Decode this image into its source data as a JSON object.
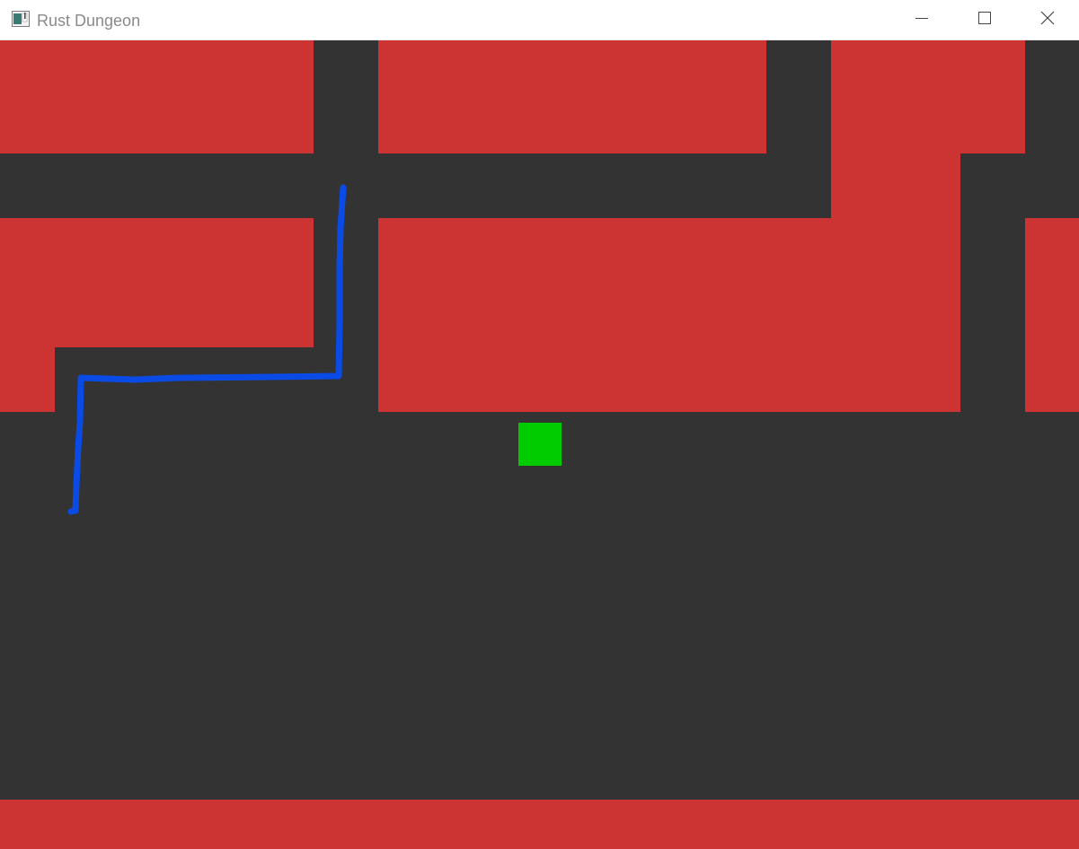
{
  "window": {
    "title": "Rust Dungeon",
    "icon": "app-window-icon",
    "controls": {
      "minimize_icon": "minimize-icon",
      "maximize_icon": "maximize-icon",
      "close_icon": "close-icon"
    }
  },
  "game": {
    "colors": {
      "floor": "#333333",
      "wall": "#cc3333",
      "player": "#00cc00",
      "path": "#0a4be6"
    },
    "map": {
      "walls": "red-wall-blocks",
      "floor": "dark-floor"
    },
    "player": {
      "shape": "square"
    },
    "path_annotation": {
      "type": "hand-drawn-line"
    }
  }
}
